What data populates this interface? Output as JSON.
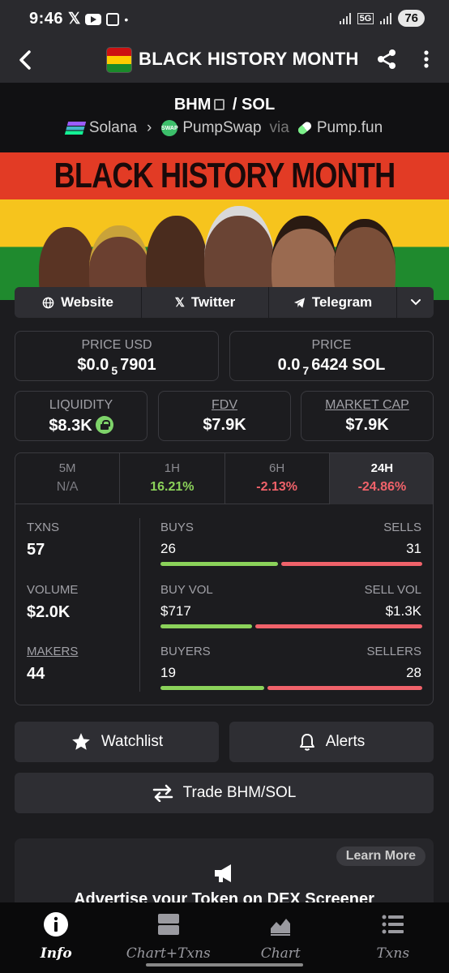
{
  "status_bar": {
    "time": "9:46",
    "net": "5G",
    "battery": "76"
  },
  "app_bar": {
    "title": "BLACK HISTORY MONTH"
  },
  "pair": {
    "base": "BHM",
    "separator": "/",
    "quote": "SOL",
    "chain": "Solana",
    "dex": "PumpSwap",
    "via": "via",
    "launchpad": "Pump.fun",
    "swap_badge": "SWAP"
  },
  "banner": {
    "text": "BLACK HISTORY MONTH"
  },
  "links": {
    "website": "Website",
    "twitter": "Twitter",
    "telegram": "Telegram"
  },
  "price_usd": {
    "label": "PRICE USD",
    "prefix": "$0.0",
    "zeros": "5",
    "digits": "7901"
  },
  "price_native": {
    "label": "PRICE",
    "prefix": "0.0",
    "zeros": "7",
    "digits": "6424 SOL"
  },
  "liquidity": {
    "label": "LIQUIDITY",
    "value": "$8.3K"
  },
  "fdv": {
    "label": "FDV",
    "value": "$7.9K"
  },
  "market_cap": {
    "label": "MARKET CAP",
    "value": "$7.9K"
  },
  "timeframes": [
    {
      "label": "5M",
      "value": "N/A"
    },
    {
      "label": "1H",
      "value": "16.21%"
    },
    {
      "label": "6H",
      "value": "-2.13%"
    },
    {
      "label": "24H",
      "value": "-24.86%"
    }
  ],
  "active_timeframe": "24H",
  "stats": {
    "txns": {
      "label": "TXNS",
      "value": "57"
    },
    "volume": {
      "label": "VOLUME",
      "value": "$2.0K"
    },
    "makers": {
      "label": "MAKERS",
      "value": "44"
    },
    "buys": {
      "label": "BUYS",
      "value": "26",
      "share": 0.456
    },
    "sells": {
      "label": "SELLS",
      "value": "31"
    },
    "buy_vol": {
      "label": "BUY VOL",
      "value": "$717",
      "share": 0.355
    },
    "sell_vol": {
      "label": "SELL VOL",
      "value": "$1.3K"
    },
    "buyers": {
      "label": "BUYERS",
      "value": "19",
      "share": 0.404
    },
    "sellers": {
      "label": "SELLERS",
      "value": "28"
    }
  },
  "actions": {
    "watchlist": "Watchlist",
    "alerts": "Alerts",
    "trade": "Trade BHM/SOL"
  },
  "ad": {
    "learn_more": "Learn More",
    "title": "Advertise your Token on DEX Screener"
  },
  "bottom_nav": [
    {
      "label": "Info",
      "icon": "info-icon"
    },
    {
      "label": "Chart+Txns",
      "icon": "split-view-icon"
    },
    {
      "label": "Chart",
      "icon": "chart-icon"
    },
    {
      "label": "Txns",
      "icon": "list-icon"
    }
  ],
  "colors": {
    "positive": "#8bd25a",
    "negative": "#f0626a",
    "background": "#1c1c1f"
  }
}
